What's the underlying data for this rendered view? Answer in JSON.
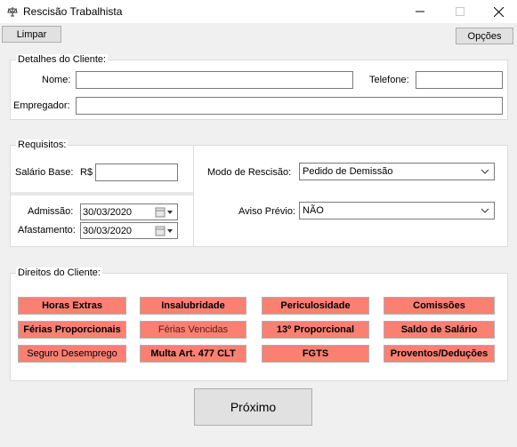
{
  "window": {
    "title": "Rescisão Trabalhista"
  },
  "toolbar": {
    "clear_label": "Limpar",
    "options_label": "Opções"
  },
  "client_details": {
    "legend": "Detalhes do Cliente:",
    "name_label": "Nome:",
    "name_value": "",
    "phone_label": "Telefone:",
    "phone_value": "",
    "employer_label": "Empregador:",
    "employer_value": ""
  },
  "requirements": {
    "legend": "Requisitos:",
    "salary_label": "Salário Base:",
    "currency": "R$",
    "salary_value": "",
    "admission_label": "Admissão:",
    "admission_value": "30/03/2020",
    "leave_label": "Afastamento:",
    "leave_value": "30/03/2020",
    "mode_label": "Modo de Rescisão:",
    "mode_value": "Pedido de Demissão",
    "notice_label": "Aviso Prévio:",
    "notice_value": "NÃO"
  },
  "rights": {
    "legend": "Direitos do Cliente:",
    "items": [
      "Horas Extras",
      "Insalubridade",
      "Periculosidade",
      "Comissões",
      "Férias Proporcionais",
      "Férias Vencidas",
      "13º Proporcional",
      "Saldo de Salário",
      "Seguro Desemprego",
      "Multa Art. 477 CLT",
      "FGTS",
      "Proventos/Deduções"
    ]
  },
  "colors": {
    "rights_button": "#fa8072"
  },
  "next_label": "Próximo"
}
